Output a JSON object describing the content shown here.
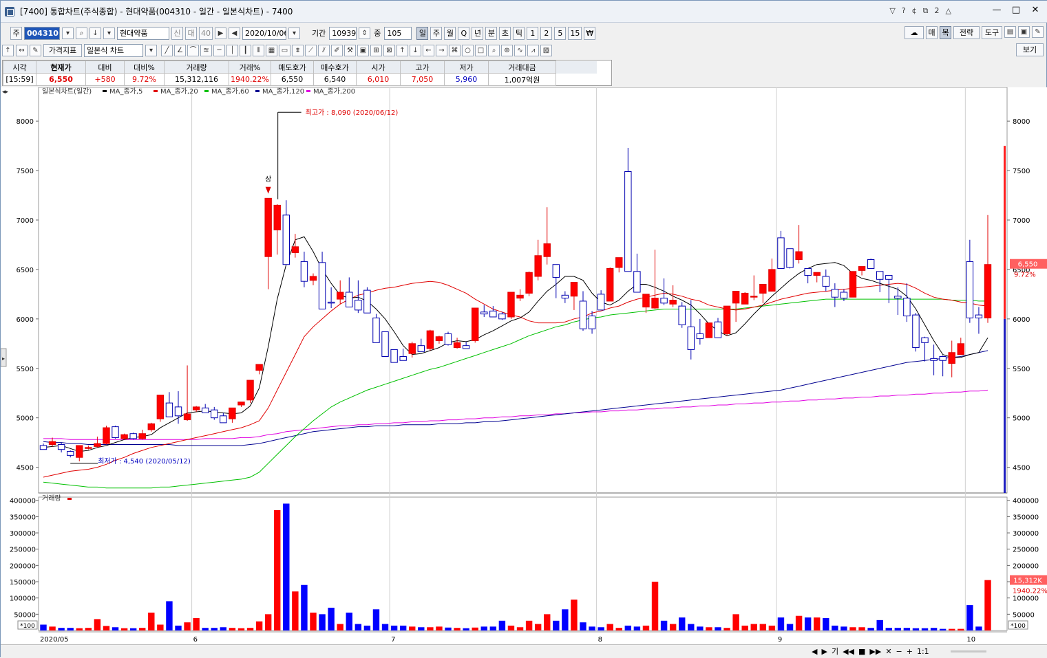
{
  "window": {
    "title": "[7400] 통합차트(주식종합) - 현대약품(004310 - 일간 - 일본식차트) - 7400",
    "title_buttons": [
      "▽",
      "?",
      "¢",
      "⧉",
      "2",
      "△"
    ],
    "controls": [
      "—",
      "□",
      "✕"
    ]
  },
  "toolbar1": {
    "label_stock": "주",
    "code": "004310",
    "name": "현대약품",
    "tags": [
      "신",
      "대",
      "40"
    ],
    "date": "2020/10/06",
    "period_label": "기간",
    "period_value": "10939",
    "middle_label": "중",
    "middle_value": "105",
    "periods": [
      "일",
      "주",
      "월",
      "Q",
      "년",
      "분",
      "초",
      "틱",
      "1",
      "2",
      "5",
      "15",
      "₩"
    ],
    "right": [
      "매",
      "복",
      "전략",
      "도구"
    ]
  },
  "toolbar2": {
    "indicator_button": "가격지표",
    "chart_type": "일본식 차트",
    "view_button": "보기"
  },
  "quote": {
    "headers": [
      "시각",
      "현재가",
      "대비",
      "대비%",
      "거래량",
      "거래%",
      "매도호가",
      "매수호가",
      "시가",
      "고가",
      "저가",
      "거래대금"
    ],
    "values": [
      "[15:59]",
      "6,550",
      "+580",
      "9.72%",
      "15,312,116",
      "1940.22%",
      "6,550",
      "6,540",
      "6,010",
      "7,050",
      "5,960",
      "1,007억원"
    ]
  },
  "colors": {
    "up": "#ff0000",
    "down": "#0000ff",
    "ma5": "#000000",
    "ma20": "#e00000",
    "ma60": "#00c000",
    "ma120": "#000090",
    "ma200": "#e000e0"
  },
  "chart": {
    "legend_title": "일본식차트(일간)",
    "legend_items": [
      "MA_종가,5",
      "MA_종가,20",
      "MA_종가,60",
      "MA_종가,120",
      "MA_종가,200"
    ],
    "high_note": "최고가 : 8,090 (2020/06/12)",
    "low_note": "최저가 : 4,540 (2020/05/12)",
    "upper_limit_mark": "상",
    "price_ticks": [
      4500,
      5000,
      5500,
      6000,
      6500,
      7000,
      7500,
      8000
    ],
    "price_tick_labels": [
      "4500",
      "5000",
      "5500",
      "6000",
      "6500",
      "7000",
      "7500",
      "8000"
    ],
    "current_price_label": "6,550",
    "current_change_label": "9.72%",
    "volume_title": "거래량",
    "volume_ticks": [
      50000,
      100000,
      150000,
      200000,
      250000,
      300000,
      350000,
      400000
    ],
    "volume_tick_labels": [
      "50000",
      "100000",
      "150000",
      "200000",
      "250000",
      "300000",
      "350000",
      "400000"
    ],
    "volume_unit": "*100",
    "current_volume_label": "15,312K",
    "current_volume_pct": "1940.22%",
    "x_labels": [
      "2020/05",
      "6",
      "7",
      "8",
      "9",
      "10"
    ]
  },
  "chart_data": {
    "type": "candlestick",
    "price_range": [
      4240,
      8300
    ],
    "volume_range": [
      0,
      410000
    ],
    "month_start_index": [
      0,
      17,
      39,
      62,
      82,
      103
    ],
    "ohlc": [
      [
        4720,
        4740,
        4680,
        4680
      ],
      [
        4730,
        4800,
        4710,
        4760
      ],
      [
        4730,
        4750,
        4650,
        4680
      ],
      [
        4660,
        4670,
        4600,
        4620
      ],
      [
        4600,
        4720,
        4560,
        4720
      ],
      [
        4690,
        4720,
        4680,
        4700
      ],
      [
        4710,
        4810,
        4700,
        4740
      ],
      [
        4740,
        4920,
        4730,
        4900
      ],
      [
        4910,
        4920,
        4790,
        4800
      ],
      [
        4790,
        4840,
        4780,
        4830
      ],
      [
        4840,
        4850,
        4780,
        4790
      ],
      [
        4790,
        4880,
        4780,
        4840
      ],
      [
        4880,
        4950,
        4860,
        4940
      ],
      [
        4990,
        5220,
        4960,
        5230
      ],
      [
        5150,
        5260,
        5010,
        5010
      ],
      [
        5110,
        5270,
        4940,
        5020
      ],
      [
        4980,
        5530,
        4970,
        5040
      ],
      [
        5080,
        5120,
        5060,
        5110
      ],
      [
        5100,
        5140,
        5050,
        5050
      ],
      [
        5080,
        5110,
        4980,
        5000
      ],
      [
        5020,
        5050,
        4950,
        4950
      ],
      [
        4990,
        5080,
        4950,
        5100
      ],
      [
        5130,
        5160,
        5110,
        5160
      ],
      [
        5180,
        5270,
        5150,
        5380
      ],
      [
        5480,
        5540,
        5440,
        5540
      ],
      [
        6630,
        7210,
        6300,
        7220
      ],
      [
        6900,
        7160,
        6650,
        7150
      ],
      [
        7050,
        7200,
        6640,
        6550
      ],
      [
        6670,
        6860,
        6620,
        6730
      ],
      [
        6580,
        6680,
        6320,
        6380
      ],
      [
        6390,
        6460,
        6340,
        6430
      ],
      [
        6570,
        6680,
        6130,
        6100
      ],
      [
        6170,
        6320,
        6110,
        6160
      ],
      [
        6200,
        6390,
        6150,
        6270
      ],
      [
        6270,
        6420,
        6220,
        6120
      ],
      [
        6190,
        6390,
        6060,
        6090
      ],
      [
        6290,
        6320,
        6080,
        6060
      ],
      [
        6010,
        6050,
        5850,
        5760
      ],
      [
        5870,
        5840,
        5660,
        5620
      ],
      [
        5690,
        5670,
        5590,
        5560
      ],
      [
        5620,
        5700,
        5630,
        5580
      ],
      [
        5650,
        5770,
        5610,
        5750
      ],
      [
        5730,
        5800,
        5700,
        5670
      ],
      [
        5700,
        5890,
        5680,
        5880
      ],
      [
        5780,
        5830,
        5750,
        5820
      ],
      [
        5850,
        5870,
        5730,
        5740
      ],
      [
        5710,
        5810,
        5700,
        5760
      ],
      [
        5730,
        5770,
        5700,
        5700
      ],
      [
        5780,
        6100,
        5760,
        6110
      ],
      [
        6070,
        6140,
        6020,
        6050
      ],
      [
        6080,
        6130,
        6020,
        6020
      ],
      [
        6050,
        6070,
        5990,
        6000
      ],
      [
        6020,
        6260,
        6000,
        6270
      ],
      [
        6210,
        6300,
        6180,
        6240
      ],
      [
        6260,
        6480,
        6230,
        6470
      ],
      [
        6430,
        6800,
        6390,
        6640
      ],
      [
        6630,
        7130,
        6550,
        6760
      ],
      [
        6550,
        6420,
        6210,
        6420
      ],
      [
        6240,
        6280,
        6160,
        6210
      ],
      [
        6230,
        6370,
        6090,
        6370
      ],
      [
        6180,
        6280,
        5880,
        5900
      ],
      [
        6030,
        6080,
        5850,
        5900
      ],
      [
        6250,
        6290,
        6110,
        6090
      ],
      [
        6180,
        6520,
        6210,
        6510
      ],
      [
        6520,
        6600,
        6470,
        6620
      ],
      [
        7490,
        7730,
        6610,
        6480
      ],
      [
        6480,
        6660,
        6290,
        6270
      ],
      [
        6120,
        6240,
        6060,
        6250
      ],
      [
        6110,
        6700,
        6100,
        6210
      ],
      [
        6210,
        6410,
        6140,
        6160
      ],
      [
        6150,
        6340,
        6120,
        6190
      ],
      [
        6130,
        6170,
        5910,
        5940
      ],
      [
        5920,
        6190,
        5590,
        5690
      ],
      [
        5850,
        6000,
        5740,
        5800
      ],
      [
        5810,
        5960,
        5850,
        5960
      ],
      [
        5970,
        6010,
        5950,
        5810
      ],
      [
        5850,
        6110,
        5830,
        6130
      ],
      [
        6160,
        6090,
        5970,
        6280
      ],
      [
        6150,
        6270,
        6200,
        6260
      ],
      [
        6220,
        6440,
        6190,
        6230
      ],
      [
        6260,
        6340,
        6160,
        6350
      ],
      [
        6280,
        6610,
        6520,
        6500
      ],
      [
        6820,
        6890,
        6660,
        6510
      ],
      [
        6710,
        6700,
        6510,
        6520
      ],
      [
        6600,
        6950,
        6560,
        6680
      ],
      [
        6510,
        6460,
        6360,
        6440
      ],
      [
        6440,
        6470,
        6370,
        6470
      ],
      [
        6430,
        6500,
        6280,
        6330
      ],
      [
        6300,
        6360,
        6120,
        6220
      ],
      [
        6270,
        6300,
        6180,
        6210
      ],
      [
        6220,
        6480,
        6220,
        6480
      ],
      [
        6490,
        6510,
        6440,
        6530
      ],
      [
        6600,
        6610,
        6530,
        6510
      ],
      [
        6480,
        6470,
        6270,
        6400
      ],
      [
        6440,
        6440,
        6160,
        6400
      ],
      [
        6230,
        6320,
        6040,
        6210
      ],
      [
        6210,
        6360,
        5970,
        6030
      ],
      [
        6040,
        6060,
        5670,
        5710
      ],
      [
        5810,
        5820,
        5570,
        5760
      ],
      [
        5600,
        5740,
        5430,
        5580
      ],
      [
        5620,
        5630,
        5420,
        5580
      ],
      [
        5550,
        5780,
        5410,
        5660
      ],
      [
        5640,
        5810,
        5640,
        5750
      ],
      [
        6580,
        6800,
        5960,
        6010
      ],
      [
        6040,
        6120,
        5850,
        6010
      ],
      [
        6010,
        7050,
        5960,
        6550
      ]
    ],
    "volume": [
      18000,
      12000,
      8000,
      8000,
      7000,
      8000,
      35000,
      14000,
      10000,
      7000,
      7000,
      8000,
      55000,
      18000,
      90000,
      15000,
      25000,
      38000,
      8000,
      8000,
      10000,
      8000,
      7000,
      8000,
      28000,
      50000,
      370000,
      390000,
      120000,
      140000,
      55000,
      50000,
      70000,
      20000,
      55000,
      20000,
      15000,
      65000,
      20000,
      15000,
      15000,
      12000,
      10000,
      10000,
      12000,
      9000,
      8000,
      7000,
      9000,
      12000,
      12000,
      30000,
      15000,
      10000,
      30000,
      20000,
      50000,
      30000,
      65000,
      95000,
      25000,
      12000,
      10000,
      20000,
      8000,
      15000,
      12000,
      15000,
      150000,
      30000,
      20000,
      40000,
      20000,
      12000,
      10000,
      10000,
      8000,
      50000,
      15000,
      20000,
      20000,
      15000,
      40000,
      20000,
      45000,
      40000,
      40000,
      38000,
      15000,
      12000,
      10000,
      10000,
      8000,
      32000,
      8000,
      8000,
      8000,
      7000,
      7000,
      8000,
      5000,
      5000,
      5000,
      78000,
      12000,
      155000
    ],
    "ma5": [
      4700,
      4710,
      4720,
      4690,
      4660,
      4670,
      4700,
      4720,
      4750,
      4780,
      4800,
      4810,
      4830,
      4900,
      4950,
      5000,
      5050,
      5060,
      5070,
      5060,
      5050,
      5040,
      5050,
      5120,
      5300,
      5720,
      6200,
      6550,
      6800,
      6830,
      6680,
      6500,
      6360,
      6240,
      6210,
      6220,
      6180,
      6100,
      6000,
      5870,
      5730,
      5640,
      5650,
      5680,
      5710,
      5760,
      5780,
      5770,
      5790,
      5840,
      5880,
      5930,
      5980,
      6010,
      6070,
      6180,
      6280,
      6350,
      6430,
      6430,
      6390,
      6260,
      6170,
      6140,
      6190,
      6280,
      6350,
      6350,
      6320,
      6280,
      6230,
      6190,
      6140,
      6050,
      5950,
      5880,
      5830,
      5860,
      5950,
      6050,
      6140,
      6230,
      6310,
      6390,
      6460,
      6510,
      6550,
      6560,
      6570,
      6540,
      6460,
      6410,
      6390,
      6360,
      6330,
      6300,
      6230,
      6100,
      5940,
      5780,
      5640,
      5610,
      5610,
      5640,
      5660,
      5810,
      5950
    ],
    "ma20": [
      4400,
      4420,
      4440,
      4460,
      4470,
      4480,
      4500,
      4530,
      4570,
      4600,
      4640,
      4670,
      4700,
      4720,
      4740,
      4760,
      4780,
      4800,
      4820,
      4840,
      4860,
      4880,
      4900,
      4930,
      4970,
      5100,
      5280,
      5460,
      5640,
      5820,
      5920,
      6000,
      6080,
      6150,
      6200,
      6240,
      6260,
      6290,
      6310,
      6320,
      6340,
      6360,
      6370,
      6380,
      6370,
      6340,
      6300,
      6260,
      6200,
      6150,
      6100,
      6070,
      6040,
      6020,
      5980,
      5960,
      5960,
      5960,
      5970,
      6000,
      6020,
      6060,
      6080,
      6110,
      6130,
      6170,
      6200,
      6220,
      6240,
      6260,
      6250,
      6230,
      6200,
      6180,
      6140,
      6120,
      6100,
      6090,
      6100,
      6120,
      6140,
      6170,
      6200,
      6220,
      6240,
      6260,
      6270,
      6280,
      6290,
      6300,
      6310,
      6320,
      6330,
      6340,
      6350,
      6360,
      6350,
      6310,
      6260,
      6220,
      6200,
      6190,
      6170,
      6160,
      6140,
      6130,
      6100
    ],
    "ma60": [
      4350,
      4340,
      4330,
      4320,
      4310,
      4300,
      4300,
      4290,
      4290,
      4290,
      4290,
      4290,
      4290,
      4300,
      4300,
      4310,
      4320,
      4330,
      4340,
      4350,
      4360,
      4370,
      4380,
      4400,
      4450,
      4540,
      4630,
      4720,
      4810,
      4890,
      4970,
      5040,
      5110,
      5160,
      5200,
      5240,
      5280,
      5310,
      5340,
      5370,
      5400,
      5430,
      5460,
      5490,
      5510,
      5540,
      5570,
      5600,
      5630,
      5660,
      5690,
      5720,
      5750,
      5790,
      5830,
      5860,
      5890,
      5920,
      5940,
      5970,
      5990,
      6010,
      6020,
      6040,
      6050,
      6060,
      6070,
      6080,
      6090,
      6100,
      6100,
      6100,
      6100,
      6100,
      6100,
      6100,
      6100,
      6100,
      6110,
      6120,
      6130,
      6140,
      6150,
      6160,
      6170,
      6180,
      6190,
      6200,
      6200,
      6200,
      6200,
      6200,
      6200,
      6200,
      6200,
      6200,
      6200,
      6200,
      6200,
      6200,
      6200,
      6190,
      6190,
      6190,
      6180,
      6180,
      6170
    ],
    "ma120": [
      4760,
      4750,
      4750,
      4740,
      4740,
      4730,
      4730,
      4730,
      4730,
      4730,
      4730,
      4730,
      4730,
      4730,
      4730,
      4720,
      4720,
      4720,
      4720,
      4720,
      4720,
      4720,
      4720,
      4730,
      4740,
      4760,
      4780,
      4800,
      4820,
      4840,
      4860,
      4870,
      4880,
      4890,
      4900,
      4910,
      4910,
      4920,
      4920,
      4920,
      4930,
      4930,
      4930,
      4930,
      4940,
      4940,
      4940,
      4950,
      4950,
      4960,
      4960,
      4970,
      4980,
      4990,
      5000,
      5010,
      5020,
      5030,
      5040,
      5050,
      5060,
      5070,
      5080,
      5090,
      5100,
      5110,
      5120,
      5130,
      5140,
      5150,
      5160,
      5170,
      5180,
      5190,
      5200,
      5210,
      5220,
      5230,
      5240,
      5250,
      5260,
      5270,
      5280,
      5300,
      5320,
      5340,
      5360,
      5380,
      5400,
      5420,
      5440,
      5460,
      5480,
      5500,
      5520,
      5540,
      5560,
      5570,
      5580,
      5590,
      5600,
      5610,
      5620,
      5640,
      5660,
      5680,
      5700
    ],
    "ma200": [
      4790,
      4790,
      4790,
      4780,
      4780,
      4780,
      4780,
      4780,
      4780,
      4780,
      4780,
      4780,
      4780,
      4780,
      4780,
      4780,
      4780,
      4780,
      4790,
      4790,
      4790,
      4790,
      4800,
      4800,
      4810,
      4830,
      4840,
      4860,
      4870,
      4880,
      4890,
      4900,
      4910,
      4920,
      4920,
      4930,
      4930,
      4940,
      4940,
      4950,
      4950,
      4960,
      4960,
      4970,
      4970,
      4980,
      4980,
      4990,
      4990,
      5000,
      5000,
      5010,
      5010,
      5020,
      5020,
      5030,
      5030,
      5040,
      5040,
      5050,
      5050,
      5060,
      5060,
      5070,
      5070,
      5080,
      5080,
      5090,
      5090,
      5100,
      5100,
      5110,
      5110,
      5120,
      5120,
      5130,
      5130,
      5140,
      5140,
      5150,
      5150,
      5160,
      5160,
      5170,
      5170,
      5180,
      5180,
      5190,
      5190,
      5200,
      5200,
      5210,
      5210,
      5220,
      5220,
      5230,
      5230,
      5240,
      5240,
      5250,
      5250,
      5260,
      5260,
      5270,
      5270,
      5280,
      5290
    ]
  },
  "statusbar": {
    "buttons": [
      "◀",
      "▶",
      "기",
      "◀◀",
      "■",
      "▶▶",
      "✕",
      "−",
      "+",
      "1:1"
    ]
  }
}
